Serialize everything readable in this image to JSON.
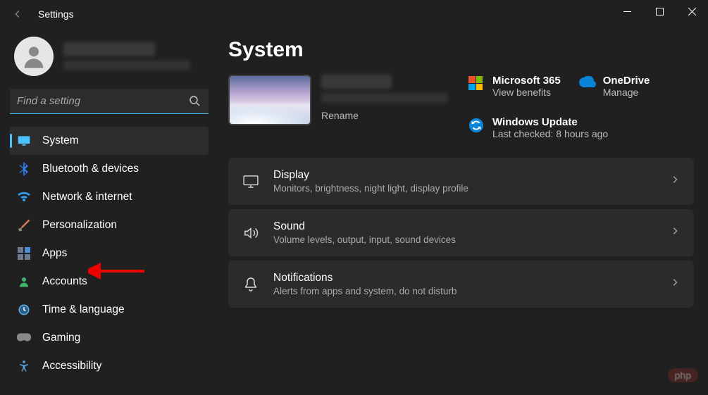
{
  "window": {
    "title": "Settings"
  },
  "search": {
    "placeholder": "Find a setting"
  },
  "sidebar": {
    "items": [
      {
        "label": "System",
        "icon": "monitor",
        "selected": true
      },
      {
        "label": "Bluetooth & devices",
        "icon": "bluetooth"
      },
      {
        "label": "Network & internet",
        "icon": "wifi"
      },
      {
        "label": "Personalization",
        "icon": "brush"
      },
      {
        "label": "Apps",
        "icon": "apps"
      },
      {
        "label": "Accounts",
        "icon": "person"
      },
      {
        "label": "Time & language",
        "icon": "clock"
      },
      {
        "label": "Gaming",
        "icon": "gamepad"
      },
      {
        "label": "Accessibility",
        "icon": "accessibility"
      }
    ]
  },
  "page": {
    "title": "System",
    "pc": {
      "rename": "Rename"
    },
    "tiles": {
      "ms365": {
        "title": "Microsoft 365",
        "sub": "View benefits"
      },
      "onedrive": {
        "title": "OneDrive",
        "sub": "Manage"
      },
      "update": {
        "title": "Windows Update",
        "sub": "Last checked: 8 hours ago"
      }
    },
    "cards": [
      {
        "title": "Display",
        "desc": "Monitors, brightness, night light, display profile",
        "icon": "display"
      },
      {
        "title": "Sound",
        "desc": "Volume levels, output, input, sound devices",
        "icon": "sound"
      },
      {
        "title": "Notifications",
        "desc": "Alerts from apps and system, do not disturb",
        "icon": "bell"
      }
    ]
  },
  "badge": "php"
}
